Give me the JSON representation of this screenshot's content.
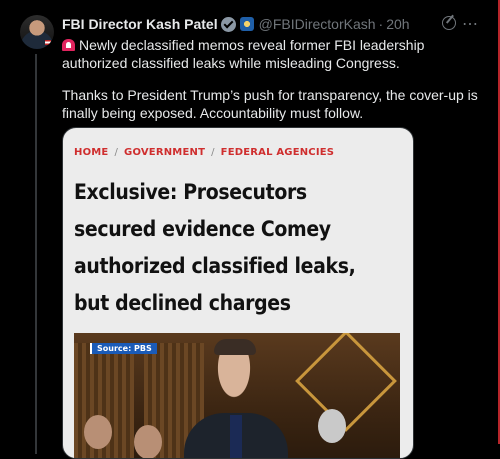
{
  "author": {
    "display_name": "FBI Director Kash Patel",
    "handle": "@FBIDirectorKash",
    "separator": "·",
    "time": "20h"
  },
  "tweet": {
    "line1": "Newly declassified memos reveal former FBI leadership authorized classified leaks while misleading Congress.",
    "line2": "Thanks to President Trump’s push for transparency, the cover-up is finally being exposed. Accountability must follow."
  },
  "card": {
    "breadcrumb": [
      "HOME",
      "GOVERNMENT",
      "FEDERAL AGENCIES"
    ],
    "breadcrumb_sep": "/",
    "headline": "Exclusive: Prosecutors secured evidence Comey authorized classified leaks, but declined charges",
    "photo_source": "Source: PBS"
  },
  "icons": {
    "verified": "verified-badge-icon",
    "affiliation": "fbi-seal-icon",
    "grok": "grok-icon",
    "more": "more-options-icon",
    "siren": "siren-icon"
  },
  "colors": {
    "background": "#000000",
    "text": "#e7e9ea",
    "muted": "#71767b",
    "breadcrumb": "#cf2e2e",
    "card_bg": "#ececec"
  }
}
